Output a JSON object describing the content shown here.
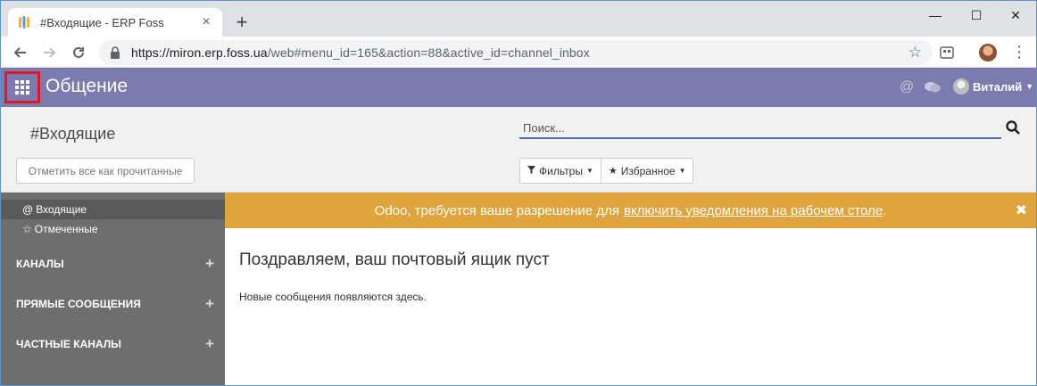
{
  "browser": {
    "tab_title": "#Входящие - ERP Foss",
    "tab_close": "×",
    "new_tab": "+",
    "url_host": "https://miron.erp.foss.ua",
    "url_path": "/web#menu_id=165&action=88&active_id=channel_inbox",
    "window_controls": {
      "minimize": "—",
      "maximize": "☐",
      "close": "✕"
    },
    "menu_glyph": "⋮",
    "bookmark_glyph": "☆"
  },
  "header": {
    "app_title": "Общение",
    "mention_glyph": "@",
    "chat_glyph": "💬",
    "user_name": "Виталий",
    "caret": "▼"
  },
  "control_panel": {
    "breadcrumb": "#Входящие",
    "mark_all_read": "Отметить все как прочитанные",
    "search_placeholder": "Поиск...",
    "filters_label": "Фильтры",
    "favorites_label": "Избранное"
  },
  "sidebar": {
    "items": [
      {
        "icon": "@",
        "label": "Входящие"
      },
      {
        "icon": "☆",
        "label": "Отмеченные"
      }
    ],
    "sections": [
      {
        "label": "КАНАЛЫ",
        "add": "+"
      },
      {
        "label": "ПРЯМЫЕ СООБЩЕНИЯ",
        "add": "+"
      },
      {
        "label": "ЧАСТНЫЕ КАНАЛЫ",
        "add": "+"
      }
    ]
  },
  "main": {
    "notification_prefix": "Odoo, требуется ваше разрешение для",
    "notification_link": "включить уведомления на рабочем столе",
    "notification_suffix": ".",
    "notification_close": "✖",
    "empty_title": "Поздравляем, ваш почтовый ящик пуст",
    "empty_subtitle": "Новые сообщения появляются здесь."
  },
  "colors": {
    "header_bg": "#7c7bad",
    "highlight_border": "#e0162b",
    "notification_bg": "#e0a43f",
    "sidebar_bg": "#6e6e6e"
  }
}
